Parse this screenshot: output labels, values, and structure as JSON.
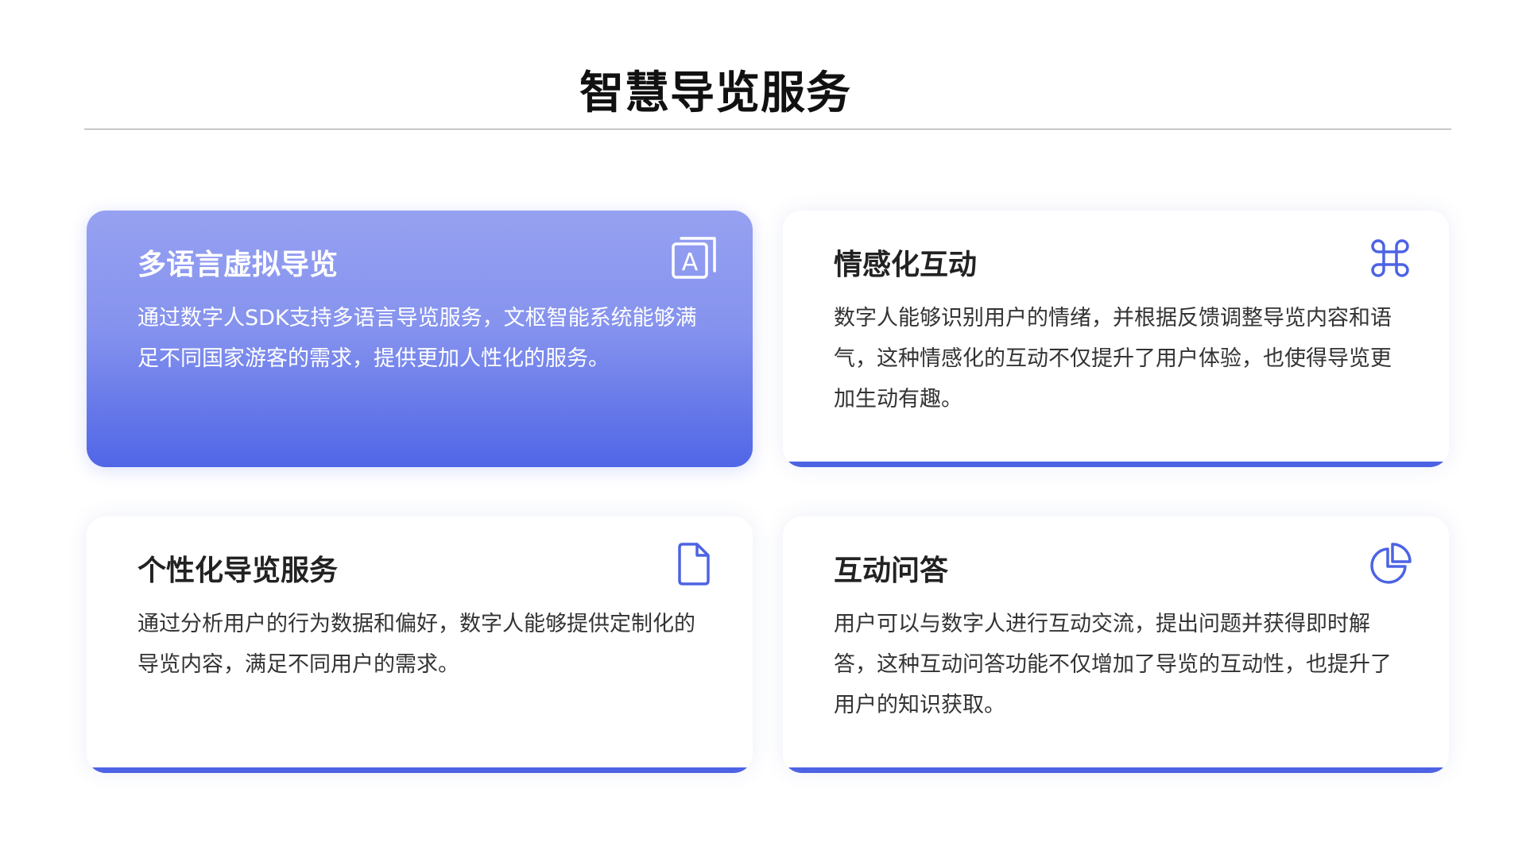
{
  "page": {
    "title": "智慧导览服务"
  },
  "colors": {
    "accent": "#4d63e4",
    "active_gradient_top": "#96a1f1",
    "active_gradient_bottom": "#5066e6"
  },
  "cards": [
    {
      "title": "多语言虚拟导览",
      "body": "通过数字人SDK支持多语言导览服务，文枢智能系统能够满足不同国家游客的需求，提供更加人性化的服务。",
      "icon": "translate-icon",
      "active": true
    },
    {
      "title": "情感化互动",
      "body": "数字人能够识别用户的情绪，并根据反馈调整导览内容和语气，这种情感化的互动不仅提升了用户体验，也使得导览更加生动有趣。",
      "icon": "command-icon",
      "active": false
    },
    {
      "title": "个性化导览服务",
      "body": "通过分析用户的行为数据和偏好，数字人能够提供定制化的导览内容，满足不同用户的需求。",
      "icon": "document-icon",
      "active": false
    },
    {
      "title": "互动问答",
      "body": "用户可以与数字人进行互动交流，提出问题并获得即时解答，这种互动问答功能不仅增加了导览的互动性，也提升了用户的知识获取。",
      "icon": "pie-chart-icon",
      "active": false
    }
  ]
}
